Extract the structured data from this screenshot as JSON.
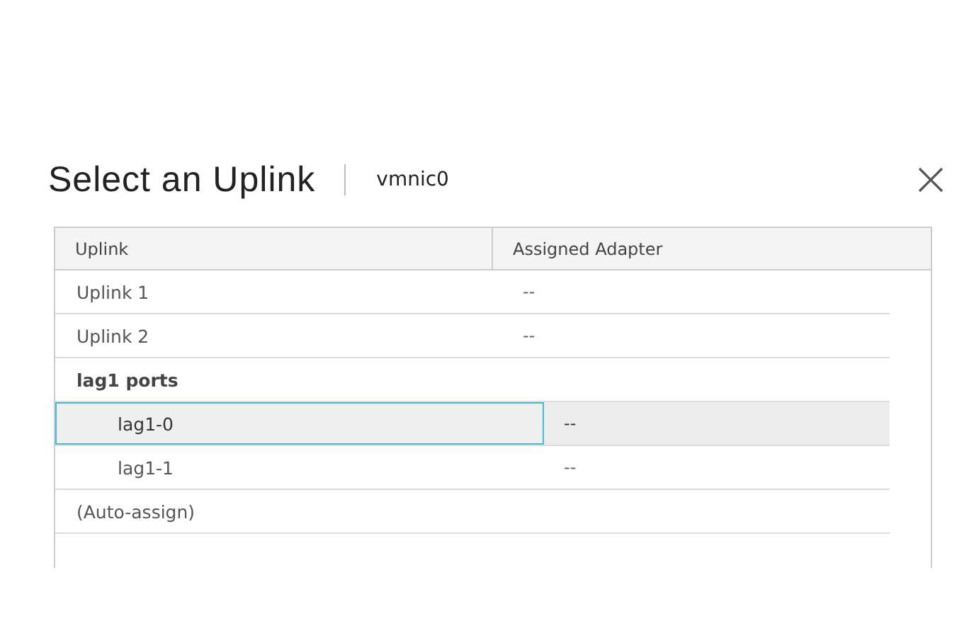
{
  "dialog": {
    "title": "Select an Uplink",
    "subtitle": "vmnic0"
  },
  "table": {
    "columns": [
      "Uplink",
      "Assigned Adapter"
    ],
    "rows": [
      {
        "uplink": "Uplink 1",
        "adapter": "--",
        "selected": false
      },
      {
        "uplink": "Uplink 2",
        "adapter": "--",
        "selected": false
      },
      {
        "uplink": "lag1 ports",
        "selected": false,
        "children": [
          {
            "uplink": "lag1-0",
            "adapter": "--",
            "selected": true
          },
          {
            "uplink": "lag1-1",
            "adapter": "--",
            "selected": false
          }
        ]
      },
      {
        "uplink": "(Auto-assign)",
        "selected": false
      }
    ]
  }
}
